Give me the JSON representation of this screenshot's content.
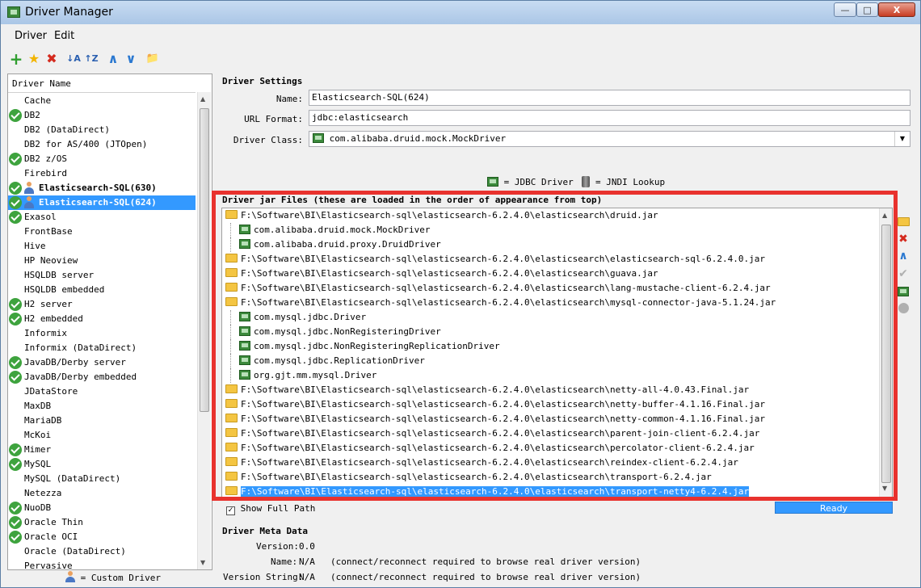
{
  "window": {
    "title": "Driver Manager",
    "min": "—",
    "max": "□",
    "close": "X"
  },
  "menu": {
    "driver": "Driver",
    "edit": "Edit"
  },
  "toolbar": {
    "add": "+",
    "fav": "★",
    "delete": "✖",
    "sort_az": "↓A",
    "sort_za": "↑Z",
    "up": "∧",
    "down": "∨",
    "folder": "📁"
  },
  "left": {
    "header": "Driver Name",
    "items": [
      {
        "label": "Cache",
        "check": false
      },
      {
        "label": "DB2",
        "check": true
      },
      {
        "label": "DB2 (DataDirect)",
        "check": false
      },
      {
        "label": "DB2 for AS/400 (JTOpen)",
        "check": false
      },
      {
        "label": "DB2 z/OS",
        "check": true
      },
      {
        "label": "Firebird",
        "check": false
      },
      {
        "label": "Elasticsearch-SQL(630)",
        "check": true,
        "custom": true
      },
      {
        "label": "Elasticsearch-SQL(624)",
        "check": true,
        "custom": true,
        "selected": true
      },
      {
        "label": "Exasol",
        "check": true
      },
      {
        "label": "FrontBase",
        "check": false
      },
      {
        "label": "Hive",
        "check": false
      },
      {
        "label": "HP Neoview",
        "check": false
      },
      {
        "label": "HSQLDB server",
        "check": false
      },
      {
        "label": "HSQLDB embedded",
        "check": false
      },
      {
        "label": "H2 server",
        "check": true
      },
      {
        "label": "H2 embedded",
        "check": true
      },
      {
        "label": "Informix",
        "check": false
      },
      {
        "label": "Informix (DataDirect)",
        "check": false
      },
      {
        "label": "JavaDB/Derby server",
        "check": true
      },
      {
        "label": "JavaDB/Derby embedded",
        "check": true
      },
      {
        "label": "JDataStore",
        "check": false
      },
      {
        "label": "MaxDB",
        "check": false
      },
      {
        "label": "MariaDB",
        "check": false
      },
      {
        "label": "McKoi",
        "check": false
      },
      {
        "label": "Mimer",
        "check": true
      },
      {
        "label": "MySQL",
        "check": true
      },
      {
        "label": "MySQL (DataDirect)",
        "check": false
      },
      {
        "label": "Netezza",
        "check": false
      },
      {
        "label": "NuoDB",
        "check": true
      },
      {
        "label": "Oracle Thin",
        "check": true
      },
      {
        "label": "Oracle OCI",
        "check": true
      },
      {
        "label": "Oracle (DataDirect)",
        "check": false
      },
      {
        "label": "Pervasive",
        "check": false
      }
    ],
    "legend": "= Custom Driver"
  },
  "settings": {
    "header": "Driver Settings",
    "name_label": "Name:",
    "name_value": "Elasticsearch-SQL(624)",
    "url_label": "URL Format:",
    "url_value": "jdbc:elasticsearch",
    "class_label": "Driver Class:",
    "class_value": "com.alibaba.druid.mock.MockDriver",
    "legend_jdbc": "= JDBC Driver",
    "legend_jndi": "= JNDI Lookup"
  },
  "jars": {
    "header": "Driver jar Files (these are loaded in the order of appearance from top)",
    "rows": [
      {
        "type": "jar",
        "text": "F:\\Software\\BI\\Elasticsearch-sql\\elasticsearch-6.2.4.0\\elasticsearch\\druid.jar"
      },
      {
        "type": "drv",
        "text": "com.alibaba.druid.mock.MockDriver"
      },
      {
        "type": "drv",
        "text": "com.alibaba.druid.proxy.DruidDriver"
      },
      {
        "type": "jar",
        "text": "F:\\Software\\BI\\Elasticsearch-sql\\elasticsearch-6.2.4.0\\elasticsearch\\elasticsearch-sql-6.2.4.0.jar"
      },
      {
        "type": "jar",
        "text": "F:\\Software\\BI\\Elasticsearch-sql\\elasticsearch-6.2.4.0\\elasticsearch\\guava.jar"
      },
      {
        "type": "jar",
        "text": "F:\\Software\\BI\\Elasticsearch-sql\\elasticsearch-6.2.4.0\\elasticsearch\\lang-mustache-client-6.2.4.jar"
      },
      {
        "type": "jar",
        "text": "F:\\Software\\BI\\Elasticsearch-sql\\elasticsearch-6.2.4.0\\elasticsearch\\mysql-connector-java-5.1.24.jar"
      },
      {
        "type": "drv",
        "text": "com.mysql.jdbc.Driver"
      },
      {
        "type": "drv",
        "text": "com.mysql.jdbc.NonRegisteringDriver"
      },
      {
        "type": "drv",
        "text": "com.mysql.jdbc.NonRegisteringReplicationDriver"
      },
      {
        "type": "drv",
        "text": "com.mysql.jdbc.ReplicationDriver"
      },
      {
        "type": "drv",
        "text": "org.gjt.mm.mysql.Driver"
      },
      {
        "type": "jar",
        "text": "F:\\Software\\BI\\Elasticsearch-sql\\elasticsearch-6.2.4.0\\elasticsearch\\netty-all-4.0.43.Final.jar"
      },
      {
        "type": "jar",
        "text": "F:\\Software\\BI\\Elasticsearch-sql\\elasticsearch-6.2.4.0\\elasticsearch\\netty-buffer-4.1.16.Final.jar"
      },
      {
        "type": "jar",
        "text": "F:\\Software\\BI\\Elasticsearch-sql\\elasticsearch-6.2.4.0\\elasticsearch\\netty-common-4.1.16.Final.jar"
      },
      {
        "type": "jar",
        "text": "F:\\Software\\BI\\Elasticsearch-sql\\elasticsearch-6.2.4.0\\elasticsearch\\parent-join-client-6.2.4.jar"
      },
      {
        "type": "jar",
        "text": "F:\\Software\\BI\\Elasticsearch-sql\\elasticsearch-6.2.4.0\\elasticsearch\\percolator-client-6.2.4.jar"
      },
      {
        "type": "jar",
        "text": "F:\\Software\\BI\\Elasticsearch-sql\\elasticsearch-6.2.4.0\\elasticsearch\\reindex-client-6.2.4.jar"
      },
      {
        "type": "jar",
        "text": "F:\\Software\\BI\\Elasticsearch-sql\\elasticsearch-6.2.4.0\\elasticsearch\\transport-6.2.4.jar"
      },
      {
        "type": "jar",
        "text": "F:\\Software\\BI\\Elasticsearch-sql\\elasticsearch-6.2.4.0\\elasticsearch\\transport-netty4-6.2.4.jar",
        "selected": true
      }
    ],
    "show_full_path": "Show Full Path",
    "ready": "Ready"
  },
  "meta": {
    "header": "Driver Meta Data",
    "version_label": "Version:",
    "version_value": "0.0",
    "name_label": "Name:",
    "name_value": "N/A",
    "name_note": "(connect/reconnect required to browse real driver version)",
    "vstring_label": "Version String:",
    "vstring_value": "N/A",
    "vstring_note": "(connect/reconnect required to browse real driver version)"
  },
  "colors": {
    "accent": "#3399ff",
    "check": "#3ea33e",
    "highlight": "#e8322e"
  }
}
